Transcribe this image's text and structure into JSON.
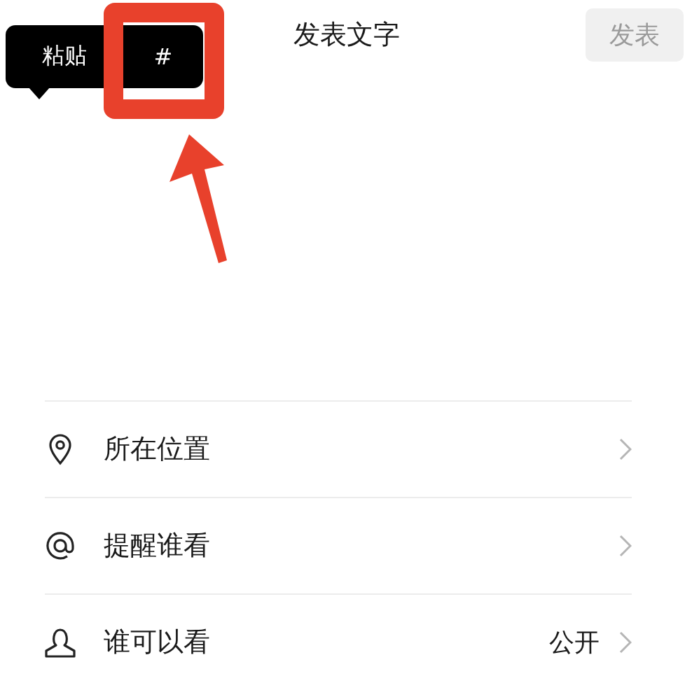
{
  "header": {
    "title": "发表文字",
    "post_button": {
      "label": "发表",
      "disabled": true
    }
  },
  "popup_menu": {
    "items": [
      {
        "label": "粘贴",
        "highlighted": false
      },
      {
        "label": "#",
        "highlighted": true
      }
    ]
  },
  "options": [
    {
      "kind": "location",
      "label": "所在位置"
    },
    {
      "kind": "mention",
      "label": "提醒谁看"
    },
    {
      "kind": "visibility",
      "label": "谁可以看",
      "value": "公开"
    }
  ]
}
